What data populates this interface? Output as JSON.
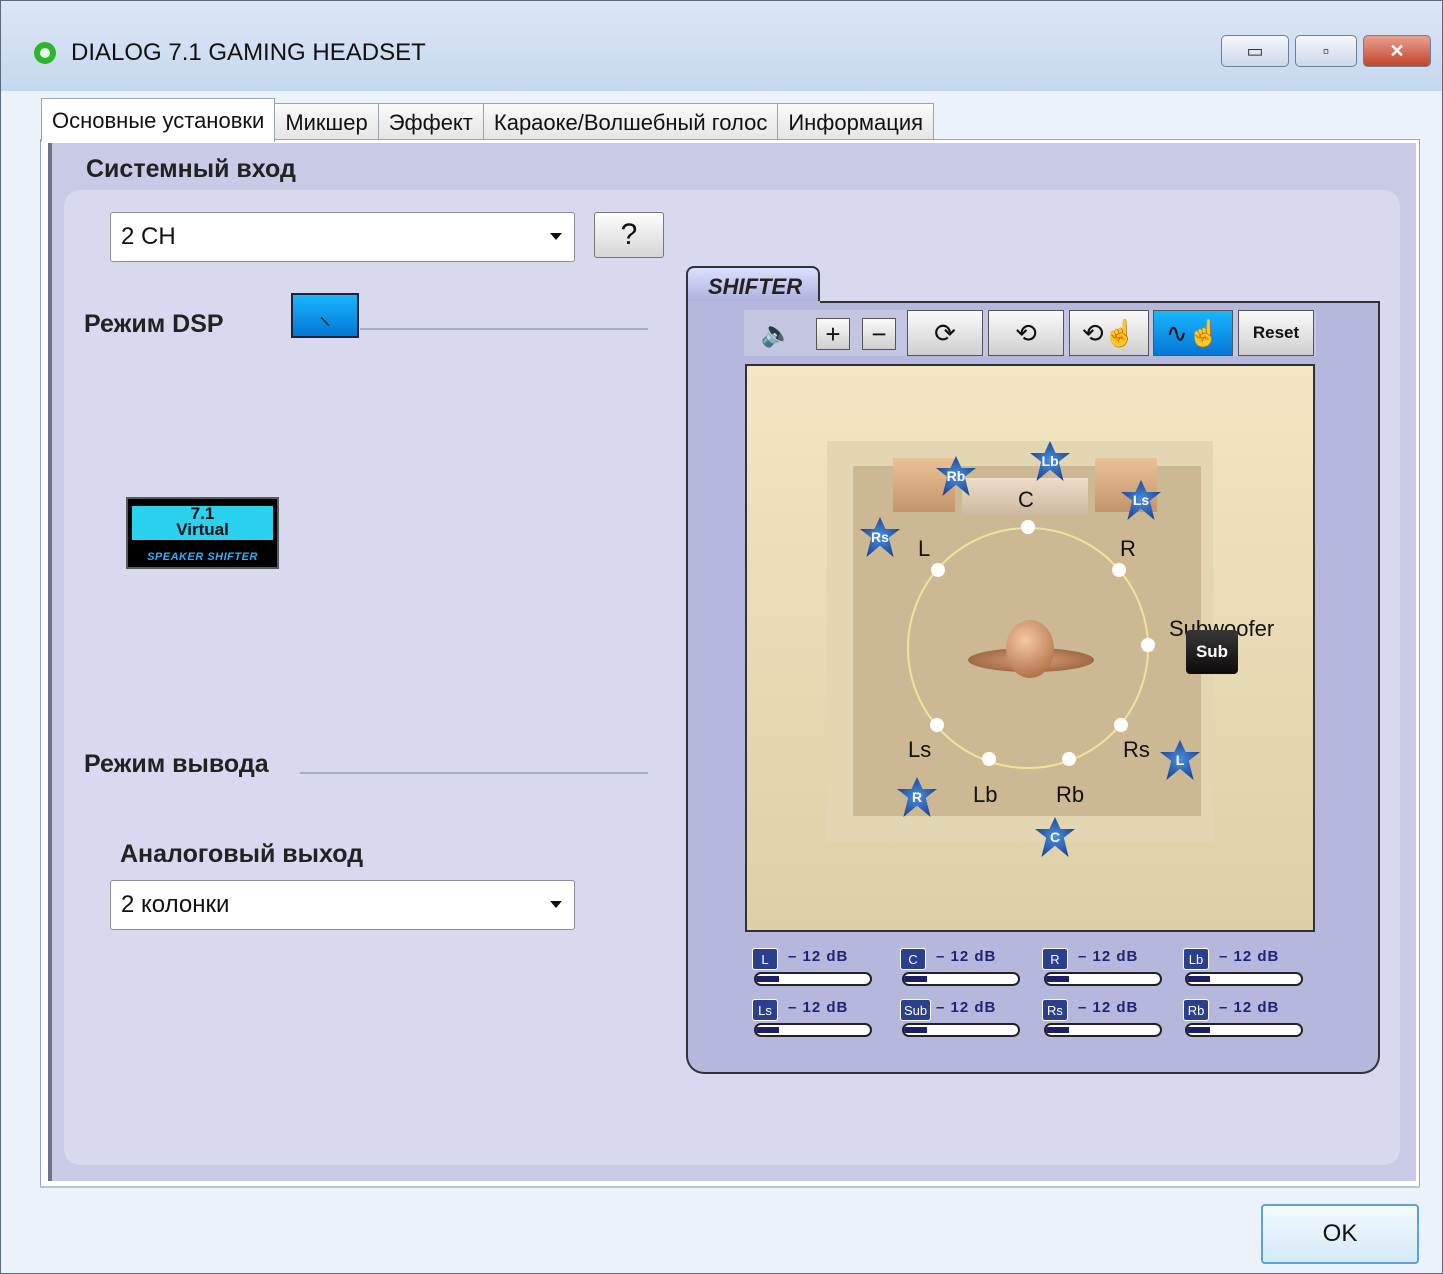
{
  "window": {
    "title": "DIALOG 7.1 GAMING HEADSET",
    "controls": {
      "minimize": "▭",
      "maximize": "▫",
      "close": "✕"
    }
  },
  "tabs": [
    {
      "label": "Основные установки",
      "active": true
    },
    {
      "label": "Микшер",
      "active": false
    },
    {
      "label": "Эффект",
      "active": false
    },
    {
      "label": "Караоке/Волшебный голос",
      "active": false
    },
    {
      "label": "Информация",
      "active": false
    }
  ],
  "system_input": {
    "title": "Системный вход",
    "selected": "2 CH",
    "help_label": "?"
  },
  "dsp": {
    "title": "Режим DSP",
    "logo": {
      "line1": "7.1",
      "line2": "Virtual",
      "line3": "SPEAKER SHIFTER"
    }
  },
  "output_mode": {
    "title": "Режим вывода",
    "analog_label": "Аналоговый выход",
    "selected": "2 колонки"
  },
  "shifter": {
    "tab_label": "SHIFTER",
    "toolbar": {
      "plus": "+",
      "minus": "−",
      "reset": "Reset"
    },
    "position_labels": {
      "c": "C",
      "l": "L",
      "r": "R",
      "subwoofer": "Subwoofer",
      "ls": "Ls",
      "rs": "Rs",
      "lb": "Lb",
      "rb": "Rb"
    },
    "speakers": {
      "rb": "Rb",
      "lb": "Lb",
      "ls": "Ls",
      "rs": "Rs",
      "l": "L",
      "r": "R",
      "c": "C",
      "sub": "Sub"
    },
    "volumes": [
      {
        "channel": "L",
        "value": "– 12 dB",
        "level": 0.2
      },
      {
        "channel": "C",
        "value": "– 12 dB",
        "level": 0.2
      },
      {
        "channel": "R",
        "value": "– 12 dB",
        "level": 0.2
      },
      {
        "channel": "Lb",
        "value": "– 12 dB",
        "level": 0.2
      },
      {
        "channel": "Ls",
        "value": "– 12 dB",
        "level": 0.2
      },
      {
        "channel": "Sub",
        "value": "– 12 dB",
        "level": 0.2
      },
      {
        "channel": "Rs",
        "value": "– 12 dB",
        "level": 0.2
      },
      {
        "channel": "Rb",
        "value": "– 12 dB",
        "level": 0.2
      }
    ]
  },
  "footer": {
    "ok_label": "OK"
  }
}
